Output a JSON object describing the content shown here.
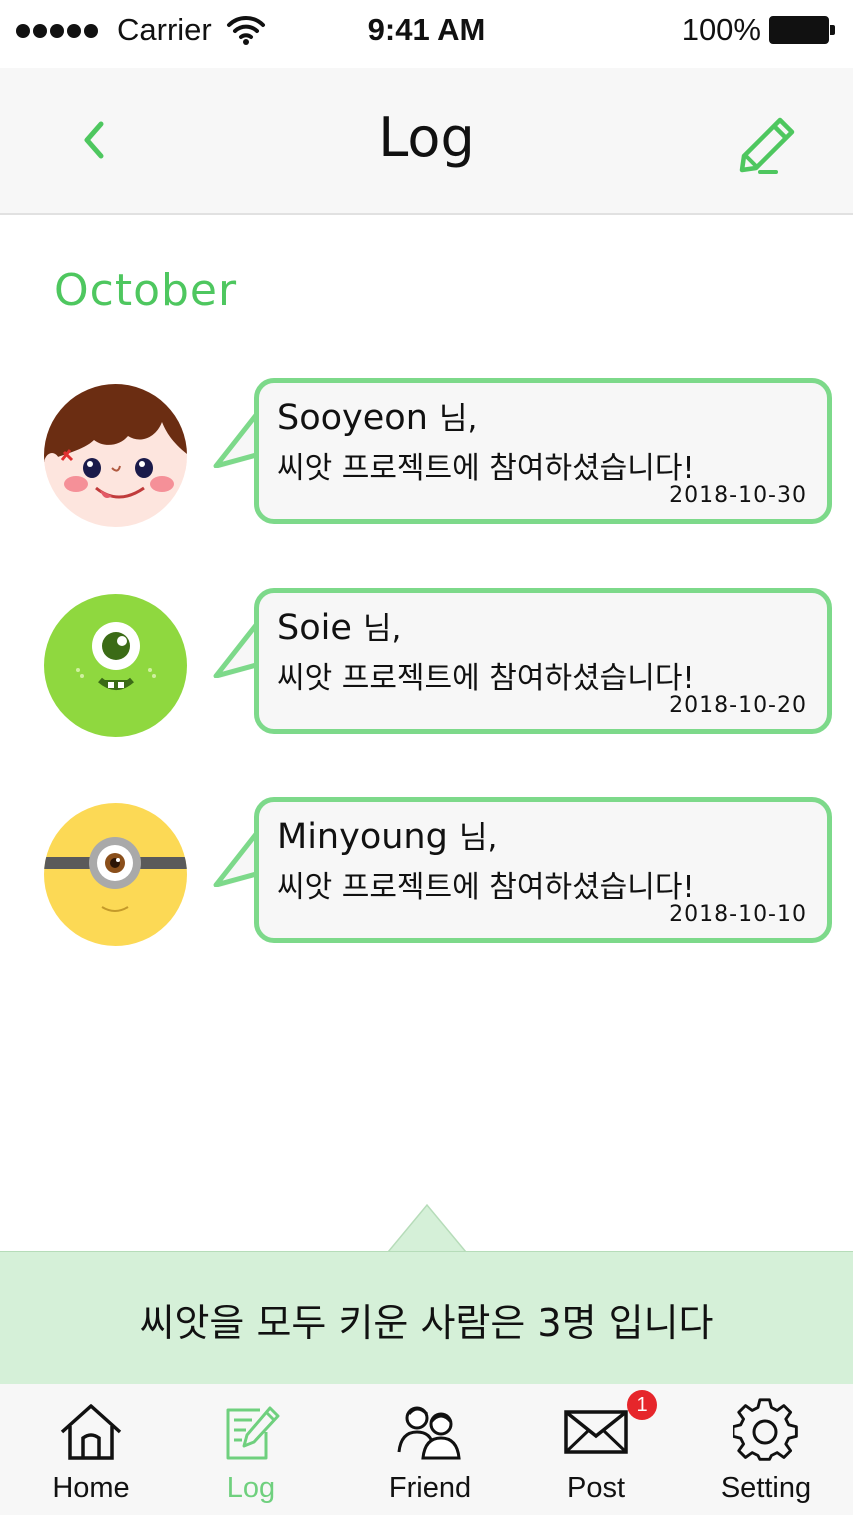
{
  "status_bar": {
    "carrier": "Carrier",
    "time": "9:41 AM",
    "battery": "100%"
  },
  "nav": {
    "title": "Log",
    "back_icon": "chevron-left-icon",
    "edit_icon": "pencil-icon"
  },
  "month": "October",
  "logs": [
    {
      "name": "Sooyeon",
      "suffix": "님,",
      "message": "씨앗 프로젝트에 참여하셨습니다!",
      "date": "2018-10-30",
      "avatar": "girl-face-icon"
    },
    {
      "name": "Soie",
      "suffix": "님,",
      "message": "씨앗 프로젝트에 참여하셨습니다!",
      "date": "2018-10-20",
      "avatar": "green-monster-icon"
    },
    {
      "name": "Minyoung",
      "suffix": "님,",
      "message": "씨앗 프로젝트에 참여하셨습니다!",
      "date": "2018-10-10",
      "avatar": "minion-icon"
    }
  ],
  "summary": "씨앗을 모두 키운 사람은 3명 입니다",
  "tabs": [
    {
      "label": "Home",
      "icon": "home-icon"
    },
    {
      "label": "Log",
      "icon": "log-icon",
      "active": true
    },
    {
      "label": "Friend",
      "icon": "friends-icon"
    },
    {
      "label": "Post",
      "icon": "envelope-icon"
    },
    {
      "label": "Setting",
      "icon": "gear-icon"
    }
  ],
  "post_badge": "1",
  "colors": {
    "accent": "#4ec75f",
    "bubble_border": "#7dd98a",
    "banner": "#d5f0d8",
    "badge": "#e6262b"
  }
}
